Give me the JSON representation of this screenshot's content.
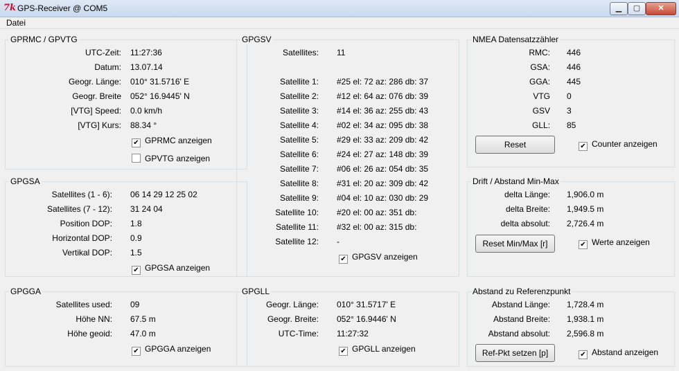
{
  "window": {
    "title": "GPS-Receiver @ COM5",
    "icon": "tk-feather-icon",
    "buttons": {
      "minimize": "▁",
      "maximize": "▢",
      "close": "✕"
    }
  },
  "menu": {
    "items": [
      "Datei"
    ]
  },
  "gprmc": {
    "title": "GPRMC / GPVTG",
    "rows": [
      {
        "label": "UTC-Zeit:",
        "value": "11:27:36"
      },
      {
        "label": "Datum:",
        "value": "13.07.14"
      },
      {
        "label": "Geogr. Länge:",
        "value": "010° 31.5716' E"
      },
      {
        "label": "Geogr. Breite",
        "value": "052° 16.9445' N"
      },
      {
        "label": "[VTG] Speed:",
        "value": "0.0 km/h"
      },
      {
        "label": "[VTG] Kurs:",
        "value": "88.34 °"
      }
    ],
    "checkboxes": [
      {
        "label": "GPRMC anzeigen",
        "checked": true
      },
      {
        "label": "GPVTG anzeigen",
        "checked": false
      }
    ]
  },
  "gpgsa": {
    "title": "GPGSA",
    "rows": [
      {
        "label": "Satellites (1 -  6):",
        "value": "06 14 29 12 25 02"
      },
      {
        "label": "Satellites (7 - 12):",
        "value": "31 24 04"
      },
      {
        "label": "Position DOP:",
        "value": "1.8"
      },
      {
        "label": "Horizontal DOP:",
        "value": "0.9"
      },
      {
        "label": "Vertikal DOP:",
        "value": "1.5"
      }
    ],
    "checkbox": {
      "label": "GPGSA anzeigen",
      "checked": true
    }
  },
  "gpgga": {
    "title": "GPGGA",
    "rows": [
      {
        "label": "Satellites used:",
        "value": "09"
      },
      {
        "label": "Höhe NN:",
        "value": "67.5 m"
      },
      {
        "label": "Höhe geoid:",
        "value": "47.0 m"
      }
    ],
    "checkbox": {
      "label": "GPGGA anzeigen",
      "checked": true
    }
  },
  "gpgsv": {
    "title": "GPGSV",
    "count_label": "Satellites:",
    "count_value": "11",
    "rows": [
      {
        "label": "Satellite 1:",
        "value": "#25 el: 72 az: 286 db: 37"
      },
      {
        "label": "Satellite 2:",
        "value": "#12 el: 64 az: 076 db: 39"
      },
      {
        "label": "Satellite 3:",
        "value": "#14 el: 36 az: 255 db: 43"
      },
      {
        "label": "Satellite 4:",
        "value": "#02 el: 34 az: 095 db: 38"
      },
      {
        "label": "Satellite 5:",
        "value": "#29 el: 33 az: 209 db: 42"
      },
      {
        "label": "Satellite 6:",
        "value": "#24 el: 27 az: 148 db: 39"
      },
      {
        "label": "Satellite 7:",
        "value": "#06 el: 26 az: 054 db: 35"
      },
      {
        "label": "Satellite 8:",
        "value": "#31 el: 20 az: 309 db: 42"
      },
      {
        "label": "Satellite 9:",
        "value": "#04 el: 10 az: 030 db: 29"
      },
      {
        "label": "Satellite 10:",
        "value": "#20 el: 00 az: 351 db:"
      },
      {
        "label": "Satellite 11:",
        "value": "#32 el: 00 az: 315 db:"
      },
      {
        "label": "Satellite 12:",
        "value": "-"
      }
    ],
    "checkbox": {
      "label": "GPGSV anzeigen",
      "checked": true
    }
  },
  "gpgll": {
    "title": "GPGLL",
    "rows": [
      {
        "label": "Geogr. Länge:",
        "value": "010° 31.5717' E"
      },
      {
        "label": "Geogr. Breite:",
        "value": "052° 16.9446' N"
      },
      {
        "label": "UTC-Time:",
        "value": "11:27:32"
      }
    ],
    "checkbox": {
      "label": "GPGLL anzeigen",
      "checked": true
    }
  },
  "nmea": {
    "title": "NMEA Datensatzzähler",
    "rows": [
      {
        "label": "RMC:",
        "value": "446"
      },
      {
        "label": "GSA:",
        "value": "446"
      },
      {
        "label": "GGA:",
        "value": "445"
      },
      {
        "label": "VTG",
        "value": "0"
      },
      {
        "label": "GSV",
        "value": "3"
      },
      {
        "label": "GLL:",
        "value": "85"
      }
    ],
    "button": "Reset",
    "checkbox": {
      "label": "Counter anzeigen",
      "checked": true
    }
  },
  "drift": {
    "title": "Drift / Abstand Min-Max",
    "rows": [
      {
        "label": "delta Länge:",
        "value": "1,906.0 m"
      },
      {
        "label": "delta Breite:",
        "value": "1,949.5 m"
      },
      {
        "label": "delta absolut:",
        "value": "2,726.4 m"
      }
    ],
    "button": "Reset Min/Max [r]",
    "checkbox": {
      "label": "Werte anzeigen",
      "checked": true
    }
  },
  "referenz": {
    "title": "Abstand zu Referenzpunkt",
    "rows": [
      {
        "label": "Abstand Länge:",
        "value": "1,728.4 m"
      },
      {
        "label": "Abstand Breite:",
        "value": "1,938.1 m"
      },
      {
        "label": "Abstand absolut:",
        "value": "2,596.8 m"
      }
    ],
    "button": "Ref-Pkt setzen [p]",
    "checkbox": {
      "label": "Abstand anzeigen",
      "checked": true
    }
  },
  "colors": {
    "close_button": "#c74a35",
    "app_icon": "#c8102e",
    "group_border": "#d5dfe5"
  }
}
